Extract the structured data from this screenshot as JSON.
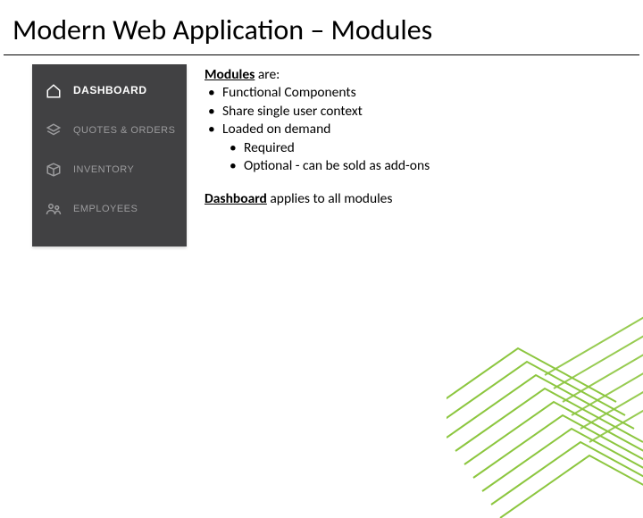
{
  "title": "Modern Web Application – Modules",
  "sidebar": {
    "items": [
      {
        "label": "DASHBOARD"
      },
      {
        "label": "QUOTES & ORDERS"
      },
      {
        "label": "INVENTORY"
      },
      {
        "label": "EMPLOYEES"
      }
    ]
  },
  "body": {
    "heading_prefix": "Modules",
    "heading_suffix": " are:",
    "bullets": [
      "Functional Components",
      "Share single user context",
      "Loaded on demand"
    ],
    "sub_bullets": [
      "Required",
      "Optional - can be sold as add-ons"
    ],
    "footer_prefix": "Dashboard",
    "footer_suffix": " applies to all modules"
  },
  "colors": {
    "accent": "#8cc63f",
    "sidebar_bg": "#414143"
  }
}
